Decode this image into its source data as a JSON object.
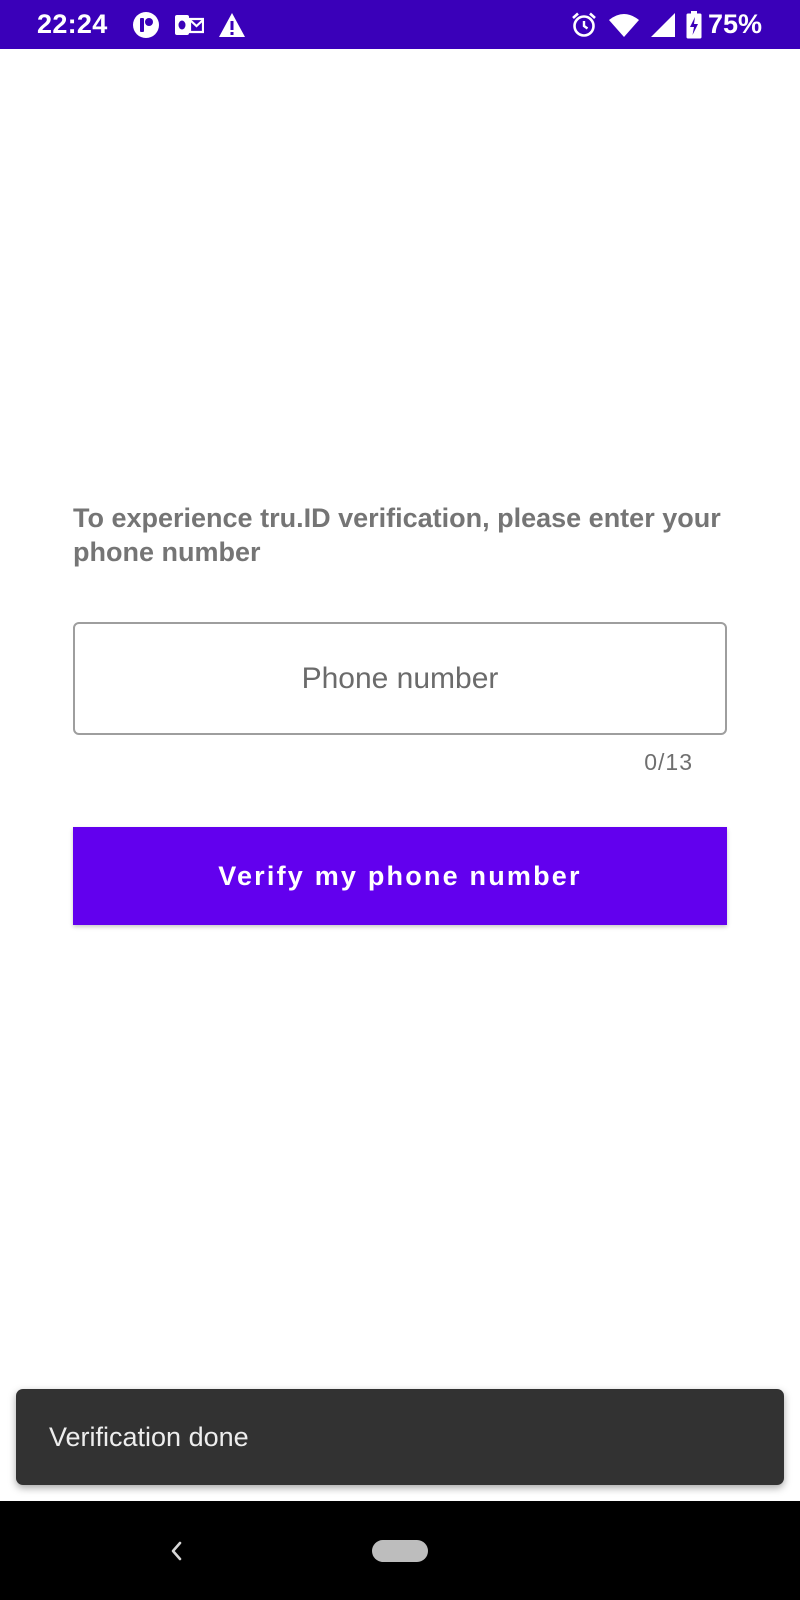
{
  "status_bar": {
    "time": "22:24",
    "battery_percent": "75%",
    "left_icons": [
      "app-circle-icon",
      "outlook-icon",
      "warning-icon"
    ],
    "right_icons": [
      "alarm-icon",
      "wifi-icon",
      "signal-icon",
      "battery-charging-icon"
    ],
    "background_color": "#3a00b9"
  },
  "main": {
    "prompt": "To experience tru.ID verification, please enter your phone number",
    "phone_input": {
      "placeholder": "Phone number",
      "value": "",
      "counter": "0/13"
    },
    "verify_button_label": "Verify my phone number",
    "accent_color": "#6200ee"
  },
  "snackbar": {
    "message": "Verification done"
  },
  "nav_bar": {
    "buttons": [
      "back-icon",
      "home-pill"
    ]
  }
}
